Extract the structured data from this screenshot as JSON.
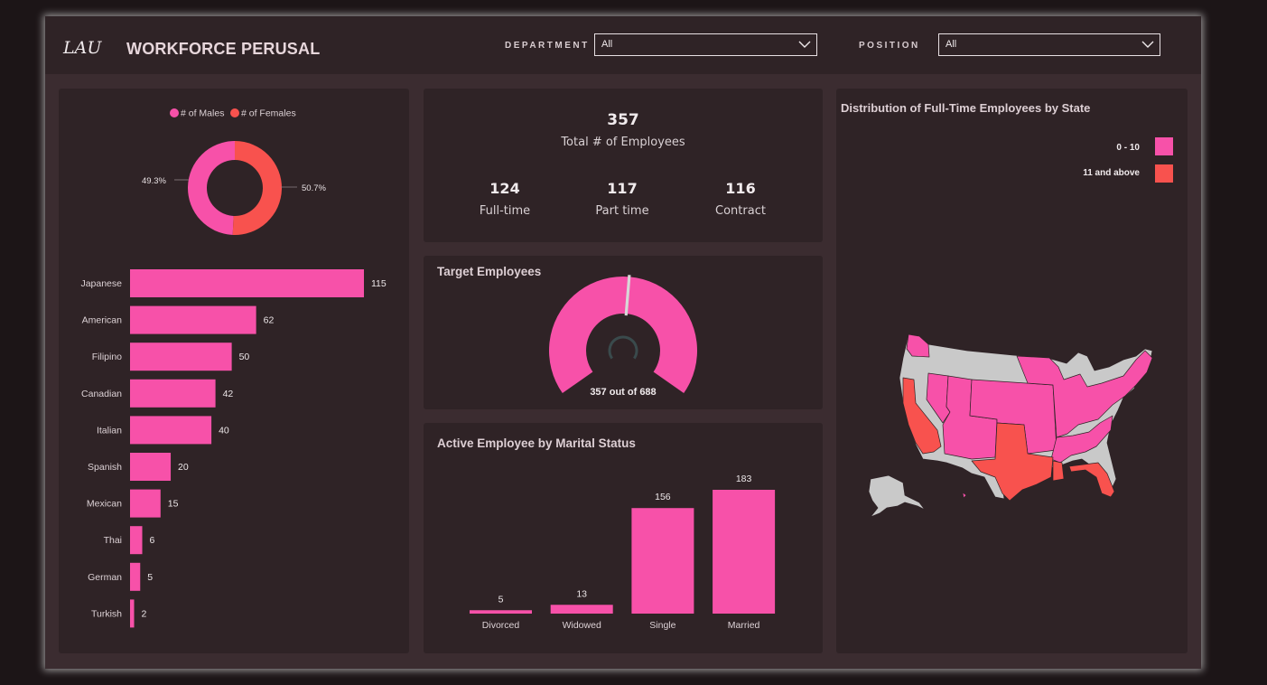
{
  "header": {
    "logo": "LAU",
    "title": "WORKFORCE PERUSAL",
    "department_label": "DEPARTMENT",
    "department_value": "All",
    "position_label": "POSITION",
    "position_value": "All"
  },
  "gender": {
    "legend": [
      {
        "label": "# of Males",
        "color": "#f751a9"
      },
      {
        "label": "# of Females",
        "color": "#f8524e"
      }
    ],
    "male_pct": "49.3%",
    "female_pct": "50.7%"
  },
  "nationality_chart": {
    "type": "bar",
    "orientation": "horizontal",
    "categories": [
      "Japanese",
      "American",
      "Filipino",
      "Canadian",
      "Italian",
      "Spanish",
      "Mexican",
      "Thai",
      "German",
      "Turkish"
    ],
    "values": [
      115,
      62,
      50,
      42,
      40,
      20,
      15,
      6,
      5,
      2
    ],
    "xlim": [
      0,
      115
    ],
    "color": "#f751a9"
  },
  "kpis": {
    "total": "357",
    "total_label": "Total # of Employees",
    "items": [
      {
        "value": "124",
        "label": "Full-time"
      },
      {
        "value": "117",
        "label": "Part time"
      },
      {
        "value": "116",
        "label": "Contract"
      }
    ]
  },
  "gauge": {
    "title": "Target Employees",
    "value": 357,
    "target": 688,
    "caption": "357 out of 688"
  },
  "marital_chart": {
    "title": "Active Employee by Marital Status",
    "type": "bar",
    "categories": [
      "Divorced",
      "Widowed",
      "Single",
      "Married"
    ],
    "values": [
      5,
      13,
      156,
      183
    ],
    "ylim": [
      0,
      183
    ],
    "color": "#f751a9"
  },
  "map": {
    "title": "Distribution of Full-Time Employees by State",
    "legend": [
      {
        "label": "0 - 10",
        "color": "#f751a9"
      },
      {
        "label": "11 and above",
        "color": "#f8524e"
      }
    ],
    "no_data_color": "#c9c9c9"
  }
}
